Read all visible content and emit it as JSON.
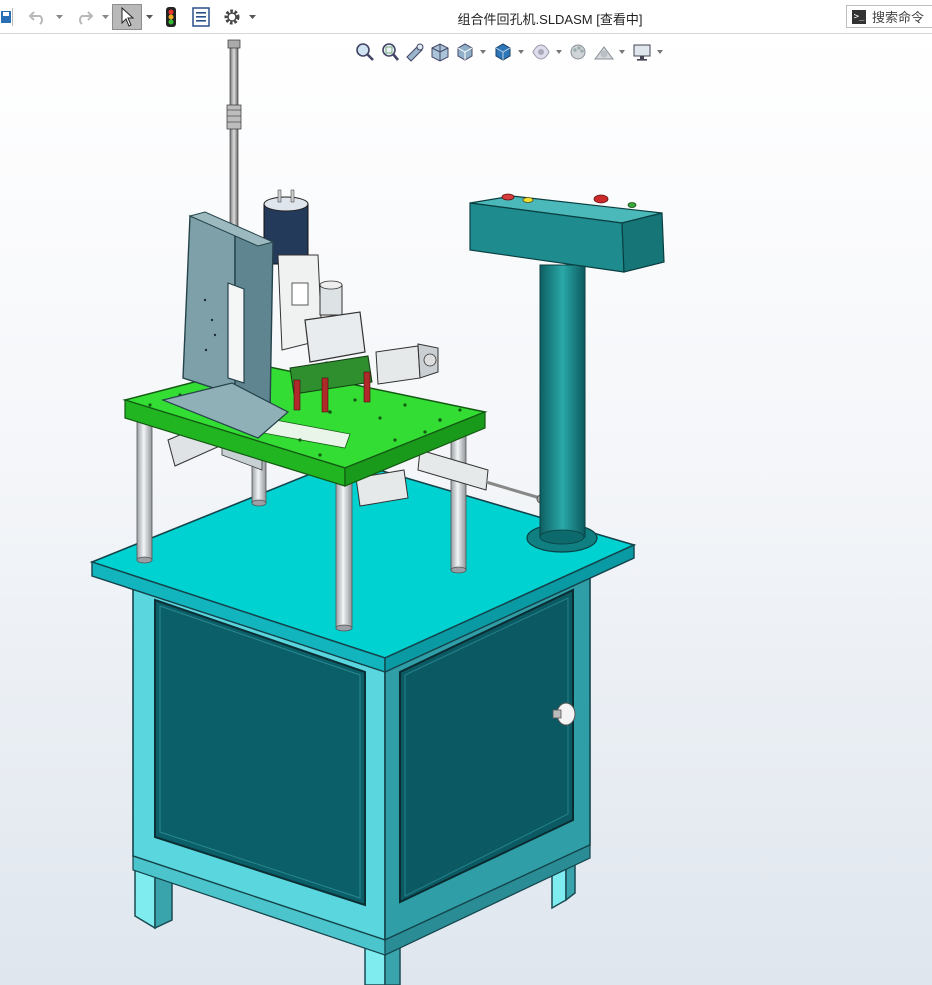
{
  "window": {
    "title": "组合件回孔机.SLDASM [查看中]"
  },
  "toolbar": {
    "icons": [
      "save-icon",
      "undo-icon",
      "redo-icon",
      "select-arrow-icon",
      "rebuild-traffic-light-icon",
      "file-properties-icon",
      "options-gear-icon"
    ]
  },
  "search": {
    "placeholder": "搜索命令"
  },
  "view_toolbar": {
    "icons": [
      "zoom-to-fit-icon",
      "zoom-to-area-icon",
      "previous-view-icon",
      "section-view-icon",
      "view-orientation-icon",
      "display-style-icon",
      "hide-show-items-icon",
      "edit-appearance-icon",
      "apply-scene-icon",
      "view-settings-icon"
    ]
  },
  "model": {
    "colors": {
      "table_top": "#00cccc",
      "cabinet_body": "#0a5d66",
      "cabinet_frame": "#3fc9d1",
      "legs": "#5fe3ea",
      "plate": "#33dd33",
      "column": "#1a8a8a",
      "control_box": "#1f8a8c",
      "posts": "#cfd3d6"
    }
  }
}
